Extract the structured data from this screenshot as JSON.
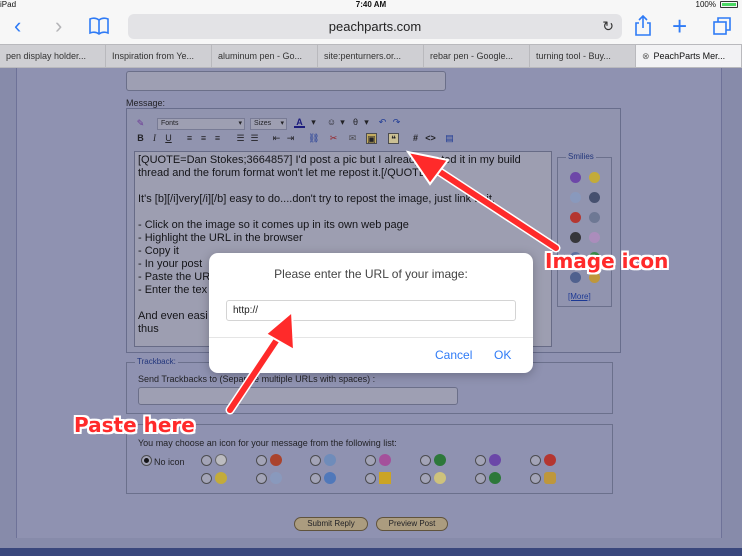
{
  "status": {
    "carrier": "iPad",
    "time": "7:40 AM",
    "battery": "100%"
  },
  "browser": {
    "url": "peachparts.com",
    "tabs": [
      {
        "label": "pen display holder..."
      },
      {
        "label": "Inspiration from Ye..."
      },
      {
        "label": "aluminum pen - Go..."
      },
      {
        "label": "site:penturners.or..."
      },
      {
        "label": "rebar pen - Google..."
      },
      {
        "label": "turning tool - Buy..."
      },
      {
        "label": "PeachParts Mer..."
      }
    ]
  },
  "form": {
    "message_label": "Message:",
    "fonts_select": "Fonts",
    "sizes_select": "Sizes",
    "smilies_title": "Smilies",
    "smilies_more": "[More]",
    "editor_lines": [
      "[QUOTE=Dan Stokes;3664857] I'd post a pic but I already posted it in my build",
      "thread and the forum format won't let me repost it.[/QUOTE]",
      "",
      "It's [b][/i]very[/i][/b] easy to do....don't try to repost the image, just link to it.",
      "",
      "- Click on the image so it comes up in its own web page",
      "- Highlight the URL in the browser",
      "- Copy it",
      "- In your post",
      "- Paste the UR",
      "- Enter the tex",
      "",
      "And even easi",
      "thus"
    ],
    "trackback_legend": "Trackback:",
    "trackback_label": "Send Trackbacks to (Separate multiple URLs with spaces) :",
    "icon_label": "You may choose an icon for your message from the following list:",
    "no_icon": "No icon",
    "submit": "Submit Reply",
    "preview": "Preview Post"
  },
  "dialog": {
    "message": "Please enter the URL of your image:",
    "input_value": "http://",
    "cancel": "Cancel",
    "ok": "OK"
  },
  "annotations": {
    "image_icon": "Image icon",
    "paste_here": "Paste here",
    "color": "#ff2a2a"
  }
}
